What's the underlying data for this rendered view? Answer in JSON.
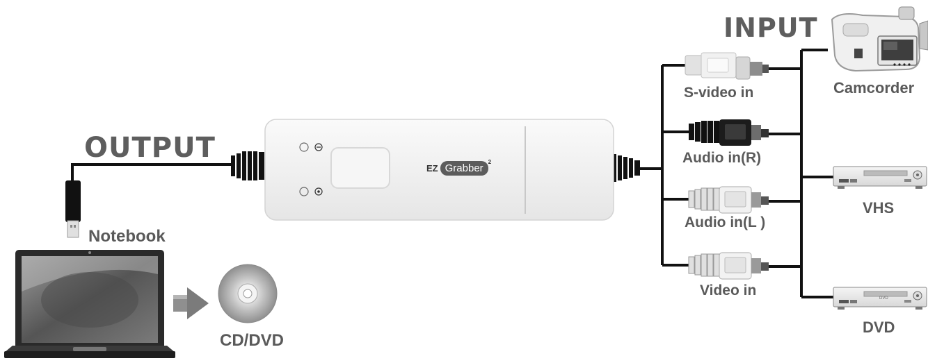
{
  "labels": {
    "output": "OUTPUT",
    "input": "INPUT",
    "notebook": "Notebook",
    "cd_dvd": "CD/DVD",
    "s_video": "S-video in",
    "audio_r": "Audio in(R)",
    "audio_l": "Audio in(L )",
    "video": "Video in",
    "camcorder": "Camcorder",
    "vhs": "VHS",
    "dvd": "DVD"
  },
  "device": {
    "brand_prefix": "EZ",
    "brand_name": "Grabber",
    "brand_suffix": "2"
  },
  "player_labels": {
    "dvd_small": "DVD"
  },
  "colors": {
    "cable": "#111111",
    "device_body": "#f1f1f1",
    "label_gray": "#6b6b6b",
    "title_gray": "#5e5e5e"
  }
}
